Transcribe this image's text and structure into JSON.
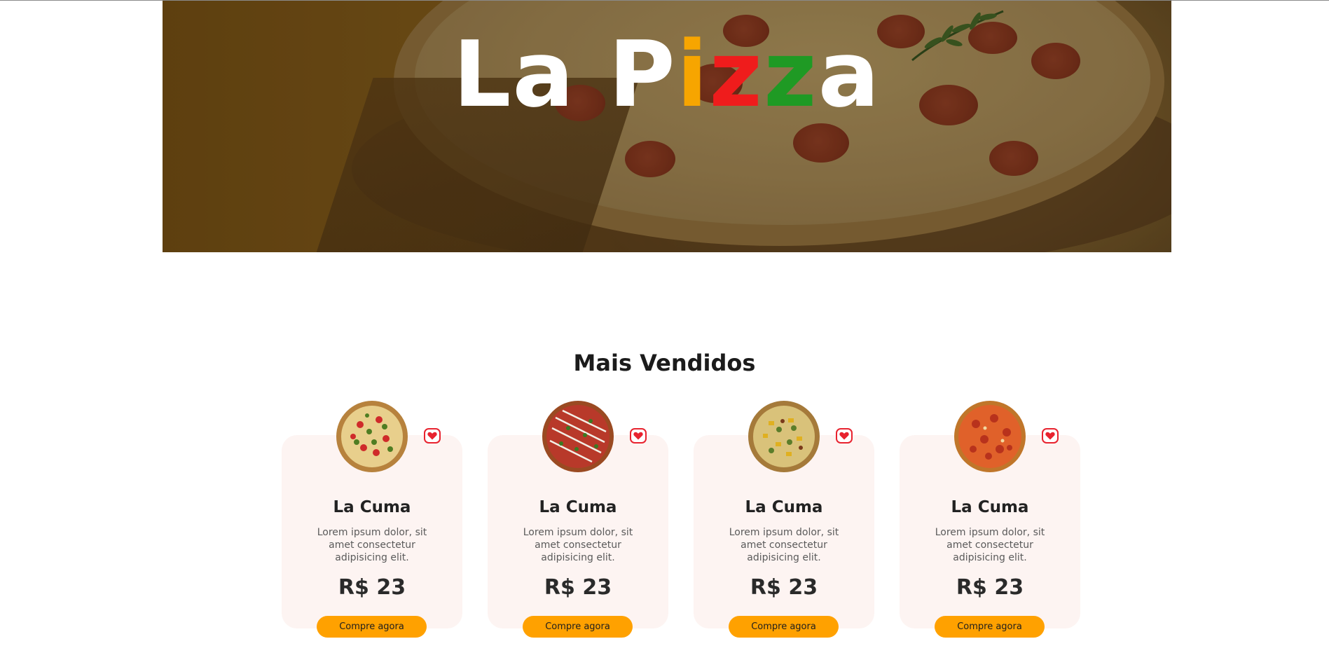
{
  "hero": {
    "title_parts": [
      "La P",
      "i",
      "z",
      "z",
      "a"
    ],
    "colors": {
      "i": "#f7a500",
      "z1": "#ef1c1c",
      "z2": "#1f9a24",
      "base": "#ffffff"
    }
  },
  "section": {
    "title": "Mais Vendidos"
  },
  "theme": {
    "card_bg": "#fdf4f2",
    "button_bg": "#ffa100",
    "heart": "#e8232f"
  },
  "products": [
    {
      "name": "La Cuma",
      "description": "Lorem ipsum dolor, sit amet consectetur adipisicing elit.",
      "price": "R$ 23",
      "button_label": "Compre agora",
      "icon": "heart-icon"
    },
    {
      "name": "La Cuma",
      "description": "Lorem ipsum dolor, sit amet consectetur adipisicing elit.",
      "price": "R$ 23",
      "button_label": "Compre agora",
      "icon": "heart-icon"
    },
    {
      "name": "La Cuma",
      "description": "Lorem ipsum dolor, sit amet consectetur adipisicing elit.",
      "price": "R$ 23",
      "button_label": "Compre agora",
      "icon": "heart-icon"
    },
    {
      "name": "La Cuma",
      "description": "Lorem ipsum dolor, sit amet consectetur adipisicing elit.",
      "price": "R$ 23",
      "button_label": "Compre agora",
      "icon": "heart-icon"
    }
  ]
}
